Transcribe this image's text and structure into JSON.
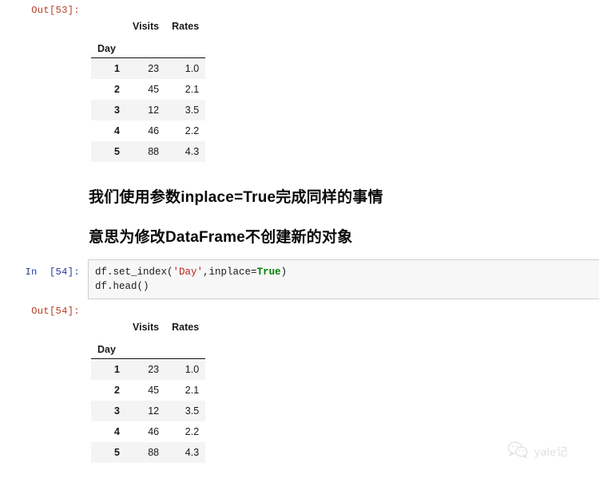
{
  "notebook": {
    "cells": [
      {
        "type": "output",
        "prompt": "Out[53]:",
        "prompt_color": "#b5391b"
      },
      {
        "type": "markdown",
        "lines": [
          "我们使用参数inplace=True完成同样的事情",
          "意思为修改DataFrame不创建新的对象"
        ]
      },
      {
        "type": "input",
        "prompt": "In  [54]:",
        "prompt_color": "#223699",
        "code_lines": [
          {
            "tokens": [
              {
                "text": "df.set_index(",
                "kind": "plain"
              },
              {
                "text": "'Day'",
                "kind": "string"
              },
              {
                "text": ",inplace=",
                "kind": "plain"
              },
              {
                "text": "True",
                "kind": "keyword"
              },
              {
                "text": ")",
                "kind": "plain"
              }
            ]
          },
          {
            "tokens": [
              {
                "text": "df.head()",
                "kind": "plain"
              }
            ]
          }
        ]
      },
      {
        "type": "output",
        "prompt": "Out[54]:",
        "prompt_color": "#b5391b"
      }
    ]
  },
  "dataframe": {
    "index_name": "Day",
    "columns": [
      "Visits",
      "Rates"
    ],
    "rows": [
      {
        "index": "1",
        "values": [
          "23",
          "1.0"
        ]
      },
      {
        "index": "2",
        "values": [
          "45",
          "2.1"
        ]
      },
      {
        "index": "3",
        "values": [
          "12",
          "3.5"
        ]
      },
      {
        "index": "4",
        "values": [
          "46",
          "2.2"
        ]
      },
      {
        "index": "5",
        "values": [
          "88",
          "4.3"
        ]
      }
    ]
  },
  "watermark": {
    "text": "yale记",
    "icon": "wechat-icon"
  },
  "colors": {
    "out_prompt": "#b5391b",
    "in_prompt": "#223699",
    "code_string": "#bb2222",
    "code_keyword": "#008000",
    "code_bg": "#f7f7f7",
    "code_border": "#cfcfcf",
    "row_stripe": "#f4f4f4"
  }
}
